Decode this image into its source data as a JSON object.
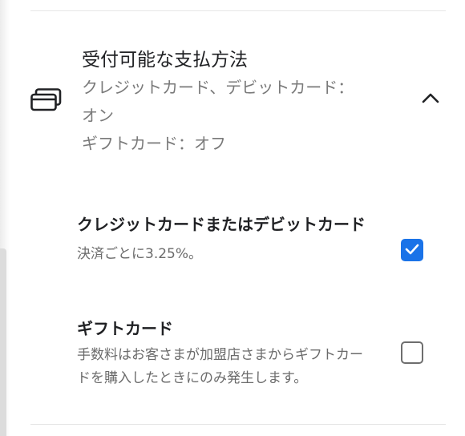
{
  "section": {
    "title": "受付可能な支払方法",
    "summary_line1": "クレジットカード、デビットカード：",
    "summary_line2": "オン",
    "summary_line3": "ギフトカード：オフ",
    "icon": "payment-cards-icon",
    "expanded": true
  },
  "options": {
    "credit": {
      "title": "クレジットカードまたはデビットカード",
      "description": "決済ごとに3.25%。",
      "checked": true
    },
    "gift": {
      "title": "ギフトカード",
      "description": "手数料はお客さまが加盟店さまからギフトカードを購入したときにのみ発生します。",
      "checked": false
    }
  },
  "colors": {
    "accent": "#1a73e8",
    "text_primary": "#202124",
    "text_secondary": "#7a7a7a"
  }
}
